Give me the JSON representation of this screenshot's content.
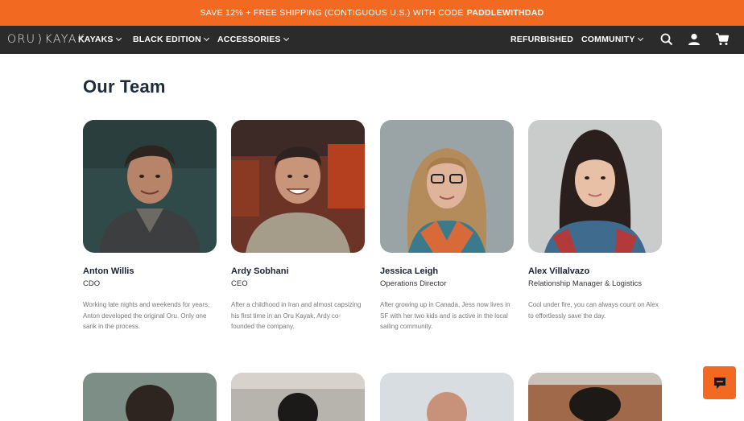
{
  "promo": {
    "text": "SAVE 12% + FREE SHIPPING (CONTIGUOUS U.S.) WITH CODE",
    "code": "PADDLEWITHDAD"
  },
  "nav": {
    "logo_left": "ORU",
    "logo_right": "KAYAK",
    "items": [
      {
        "label": "KAYAKS"
      },
      {
        "label": "BLACK EDITION"
      },
      {
        "label": "ACCESSORIES"
      },
      {
        "label": "REFURBISHED"
      },
      {
        "label": "COMMUNITY"
      }
    ],
    "icons": [
      "search-icon",
      "account-icon",
      "cart-icon"
    ]
  },
  "page": {
    "title": "Our Team"
  },
  "team": [
    {
      "name": "Anton Willis",
      "role": "CDO",
      "bio": "Working late nights and weekends for years, Anton developed the original Oru. Only one sank in the process."
    },
    {
      "name": "Ardy Sobhani",
      "role": "CEO",
      "bio": "After a childhood in Iran and almost capsizing his first time in an Oru Kayak, Ardy co-founded the company."
    },
    {
      "name": "Jessica Leigh",
      "role": "Operations Director",
      "bio": "After growing up in Canada, Jess now lives in SF with her two kids and is active in the local sailing community."
    },
    {
      "name": "Alex Villalvazo",
      "role": "Relationship Manager & Logistics",
      "bio": "Cool under fire, you can always count on Alex to effortlessly save the day."
    }
  ],
  "colors": {
    "accent": "#f26a21",
    "nav_bg": "#2b2b2b",
    "title": "#1e2b3a"
  }
}
